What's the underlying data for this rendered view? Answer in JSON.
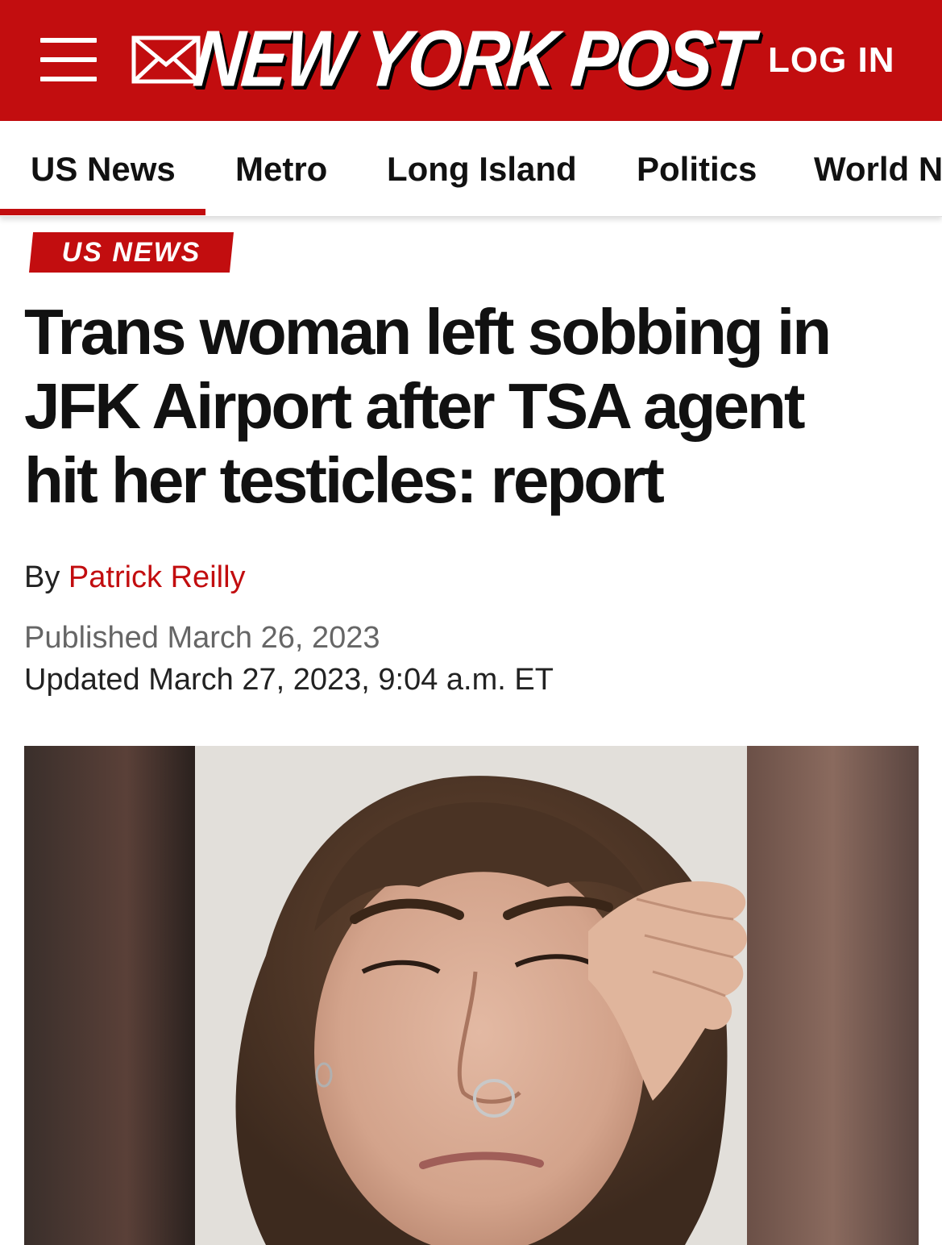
{
  "header": {
    "brand": "NEW YORK POST",
    "login_label": "LOG IN",
    "menu_icon": "hamburger-menu-icon",
    "mail_icon": "mail-icon",
    "brand_color": "#c20d0f"
  },
  "nav": {
    "items": [
      {
        "label": "US News",
        "active": true
      },
      {
        "label": "Metro"
      },
      {
        "label": "Long Island"
      },
      {
        "label": "Politics"
      },
      {
        "label": "World N"
      }
    ]
  },
  "article": {
    "section_tag": "US NEWS",
    "headline_lines": [
      "Trans woman left sobbing in",
      "JFK Airport after TSA agent",
      "hit her testicles: report"
    ],
    "byline_prefix": "By",
    "author": "Patrick Reilly",
    "published": "Published March 26, 2023",
    "updated": "Updated March 27, 2023, 9:04 a.m. ET"
  }
}
